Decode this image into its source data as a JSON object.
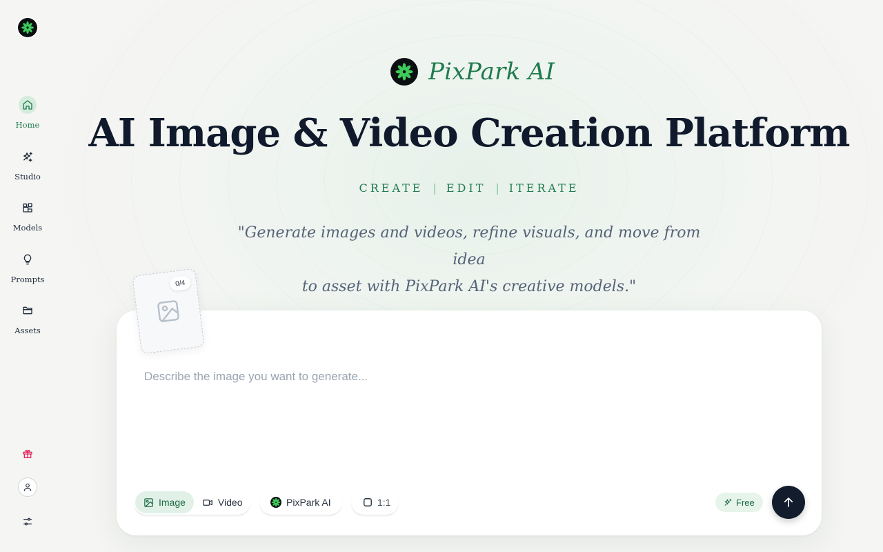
{
  "app": {
    "brand_name": "PixPark AI",
    "accent_color": "#1f7a4c",
    "brand_logo_icon": "flower-logo-icon"
  },
  "sidebar": {
    "items": [
      {
        "label": "Home",
        "icon": "home-icon",
        "active": true
      },
      {
        "label": "Studio",
        "icon": "sparkles-icon",
        "active": false
      },
      {
        "label": "Models",
        "icon": "blocks-icon",
        "active": false
      },
      {
        "label": "Prompts",
        "icon": "lightbulb-icon",
        "active": false
      },
      {
        "label": "Assets",
        "icon": "folder-icon",
        "active": false
      }
    ],
    "bottom_icons": [
      "gift-icon",
      "user-icon",
      "settings-sliders-icon"
    ]
  },
  "hero": {
    "headline": "AI Image & Video Creation Platform",
    "tagline_words": [
      "CREATE",
      "EDIT",
      "ITERATE"
    ],
    "tagline_separator": "|",
    "quote_line1": "\"Generate images and videos, refine visuals, and move from idea",
    "quote_line2": "to asset with PixPark AI's creative models.\""
  },
  "prompt": {
    "placeholder": "Describe the image you want to generate...",
    "value": "",
    "upload_count": "0/4",
    "mode_tabs": [
      {
        "label": "Image",
        "icon": "image-icon",
        "selected": true
      },
      {
        "label": "Video",
        "icon": "video-icon",
        "selected": false
      }
    ],
    "model_label": "PixPark AI",
    "aspect_ratio": "1:1",
    "plan_badge": "Free"
  }
}
